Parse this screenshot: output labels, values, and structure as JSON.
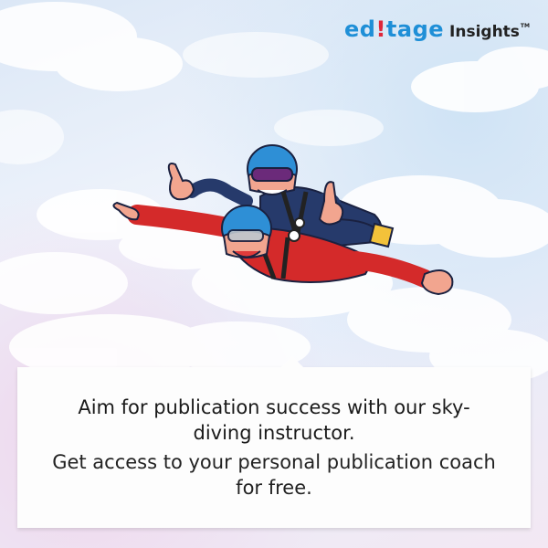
{
  "logo": {
    "brand_prefix": "ed",
    "brand_mark": "!",
    "brand_rest": "tage",
    "suffix": "Insights",
    "trademark": "TM"
  },
  "caption": {
    "headline": "Aim for publication success with our sky-diving instructor.",
    "subline": "Get access to your personal publication coach for free."
  },
  "colors": {
    "brand_blue": "#1f8fd7",
    "brand_red": "#e0273a",
    "jumpsuit_red": "#d42a2a",
    "jumpsuit_navy": "#263a6b",
    "helmet_blue": "#2e8fd6"
  },
  "illustration": {
    "icon": "tandem-skydivers-illustration"
  }
}
